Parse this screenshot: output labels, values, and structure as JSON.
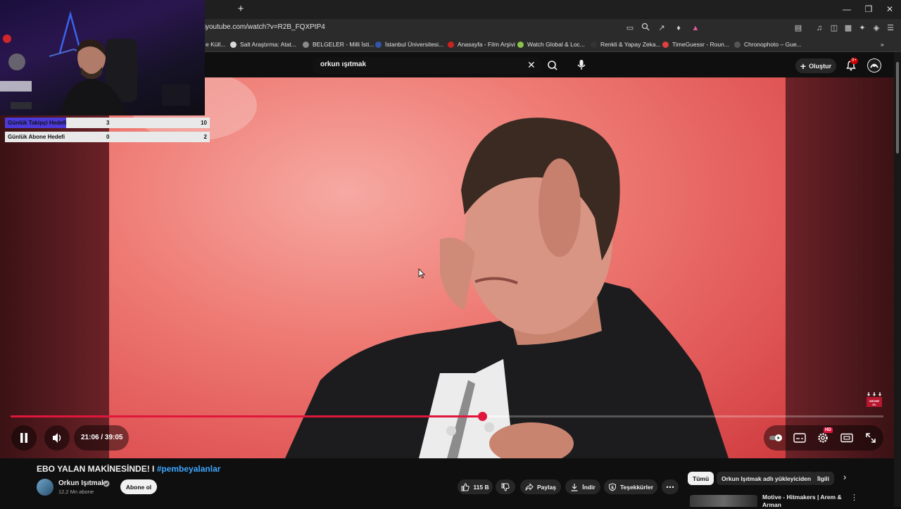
{
  "browser": {
    "url": "youtube.com/watch?v=R2B_FQXPtP4",
    "url_prefix": "s",
    "new_tab_glyph": "+",
    "bookmarks": [
      {
        "label": "e Küll...",
        "color": "#4a7bd0"
      },
      {
        "label": "Salt Araştırma: Atat...",
        "color": "#d9d9d9"
      },
      {
        "label": "BELGELER - Milli İsti...",
        "color": "#8a8a8a"
      },
      {
        "label": "İstanbul Üniversitesi...",
        "color": "#3355aa"
      },
      {
        "label": "Anasayfa - Film Arşivi",
        "color": "#cc2222"
      },
      {
        "label": "Watch Global & Loc...",
        "color": "#8bc34a"
      },
      {
        "label": "Renkli & Yapay Zeka...",
        "color": "#333333"
      },
      {
        "label": "TimeGuessr - Roun...",
        "color": "#e04040"
      },
      {
        "label": "Chronophoto – Gue...",
        "color": "#555555"
      }
    ]
  },
  "masthead": {
    "search_value": "orkun ışıtmak",
    "create_label": "Oluştur",
    "notification_count": "9+"
  },
  "stream_overlay": {
    "goals": [
      {
        "label": "Günlük Takipçi Hedefi",
        "current": "3",
        "max": "10",
        "fraction": 0.3
      },
      {
        "label": "Günlük Abone Hedefi",
        "current": "0",
        "max": "2",
        "fraction": 0.0
      }
    ]
  },
  "player": {
    "current_time": "21:06",
    "duration": "39:05",
    "time_separator": " / ",
    "progress_fraction": 0.54,
    "buffer_fraction": 0.57,
    "hd_badge": "HD",
    "watermark_text": "ABONE OL",
    "colors": {
      "progress": "#e0163c",
      "badge": "#e0163c"
    }
  },
  "video": {
    "title": "EBO YALAN MAKİNESİNDE! I",
    "hashtag": "#pembeyalanlar",
    "channel_name": "Orkun Işıtmak",
    "subscribers": "12,2 Mn abone",
    "subscribe_label": "Abone ol",
    "like_count": "115 B",
    "share_label": "Paylaş",
    "download_label": "İndir",
    "thanks_label": "Teşekkürler"
  },
  "recommendations": {
    "chips": [
      "Tümü",
      "Orkun Işıtmak adlı yükleyiciden",
      "İlgili"
    ],
    "first_title": "Motive - Hitmakers | Arem & Arman"
  }
}
